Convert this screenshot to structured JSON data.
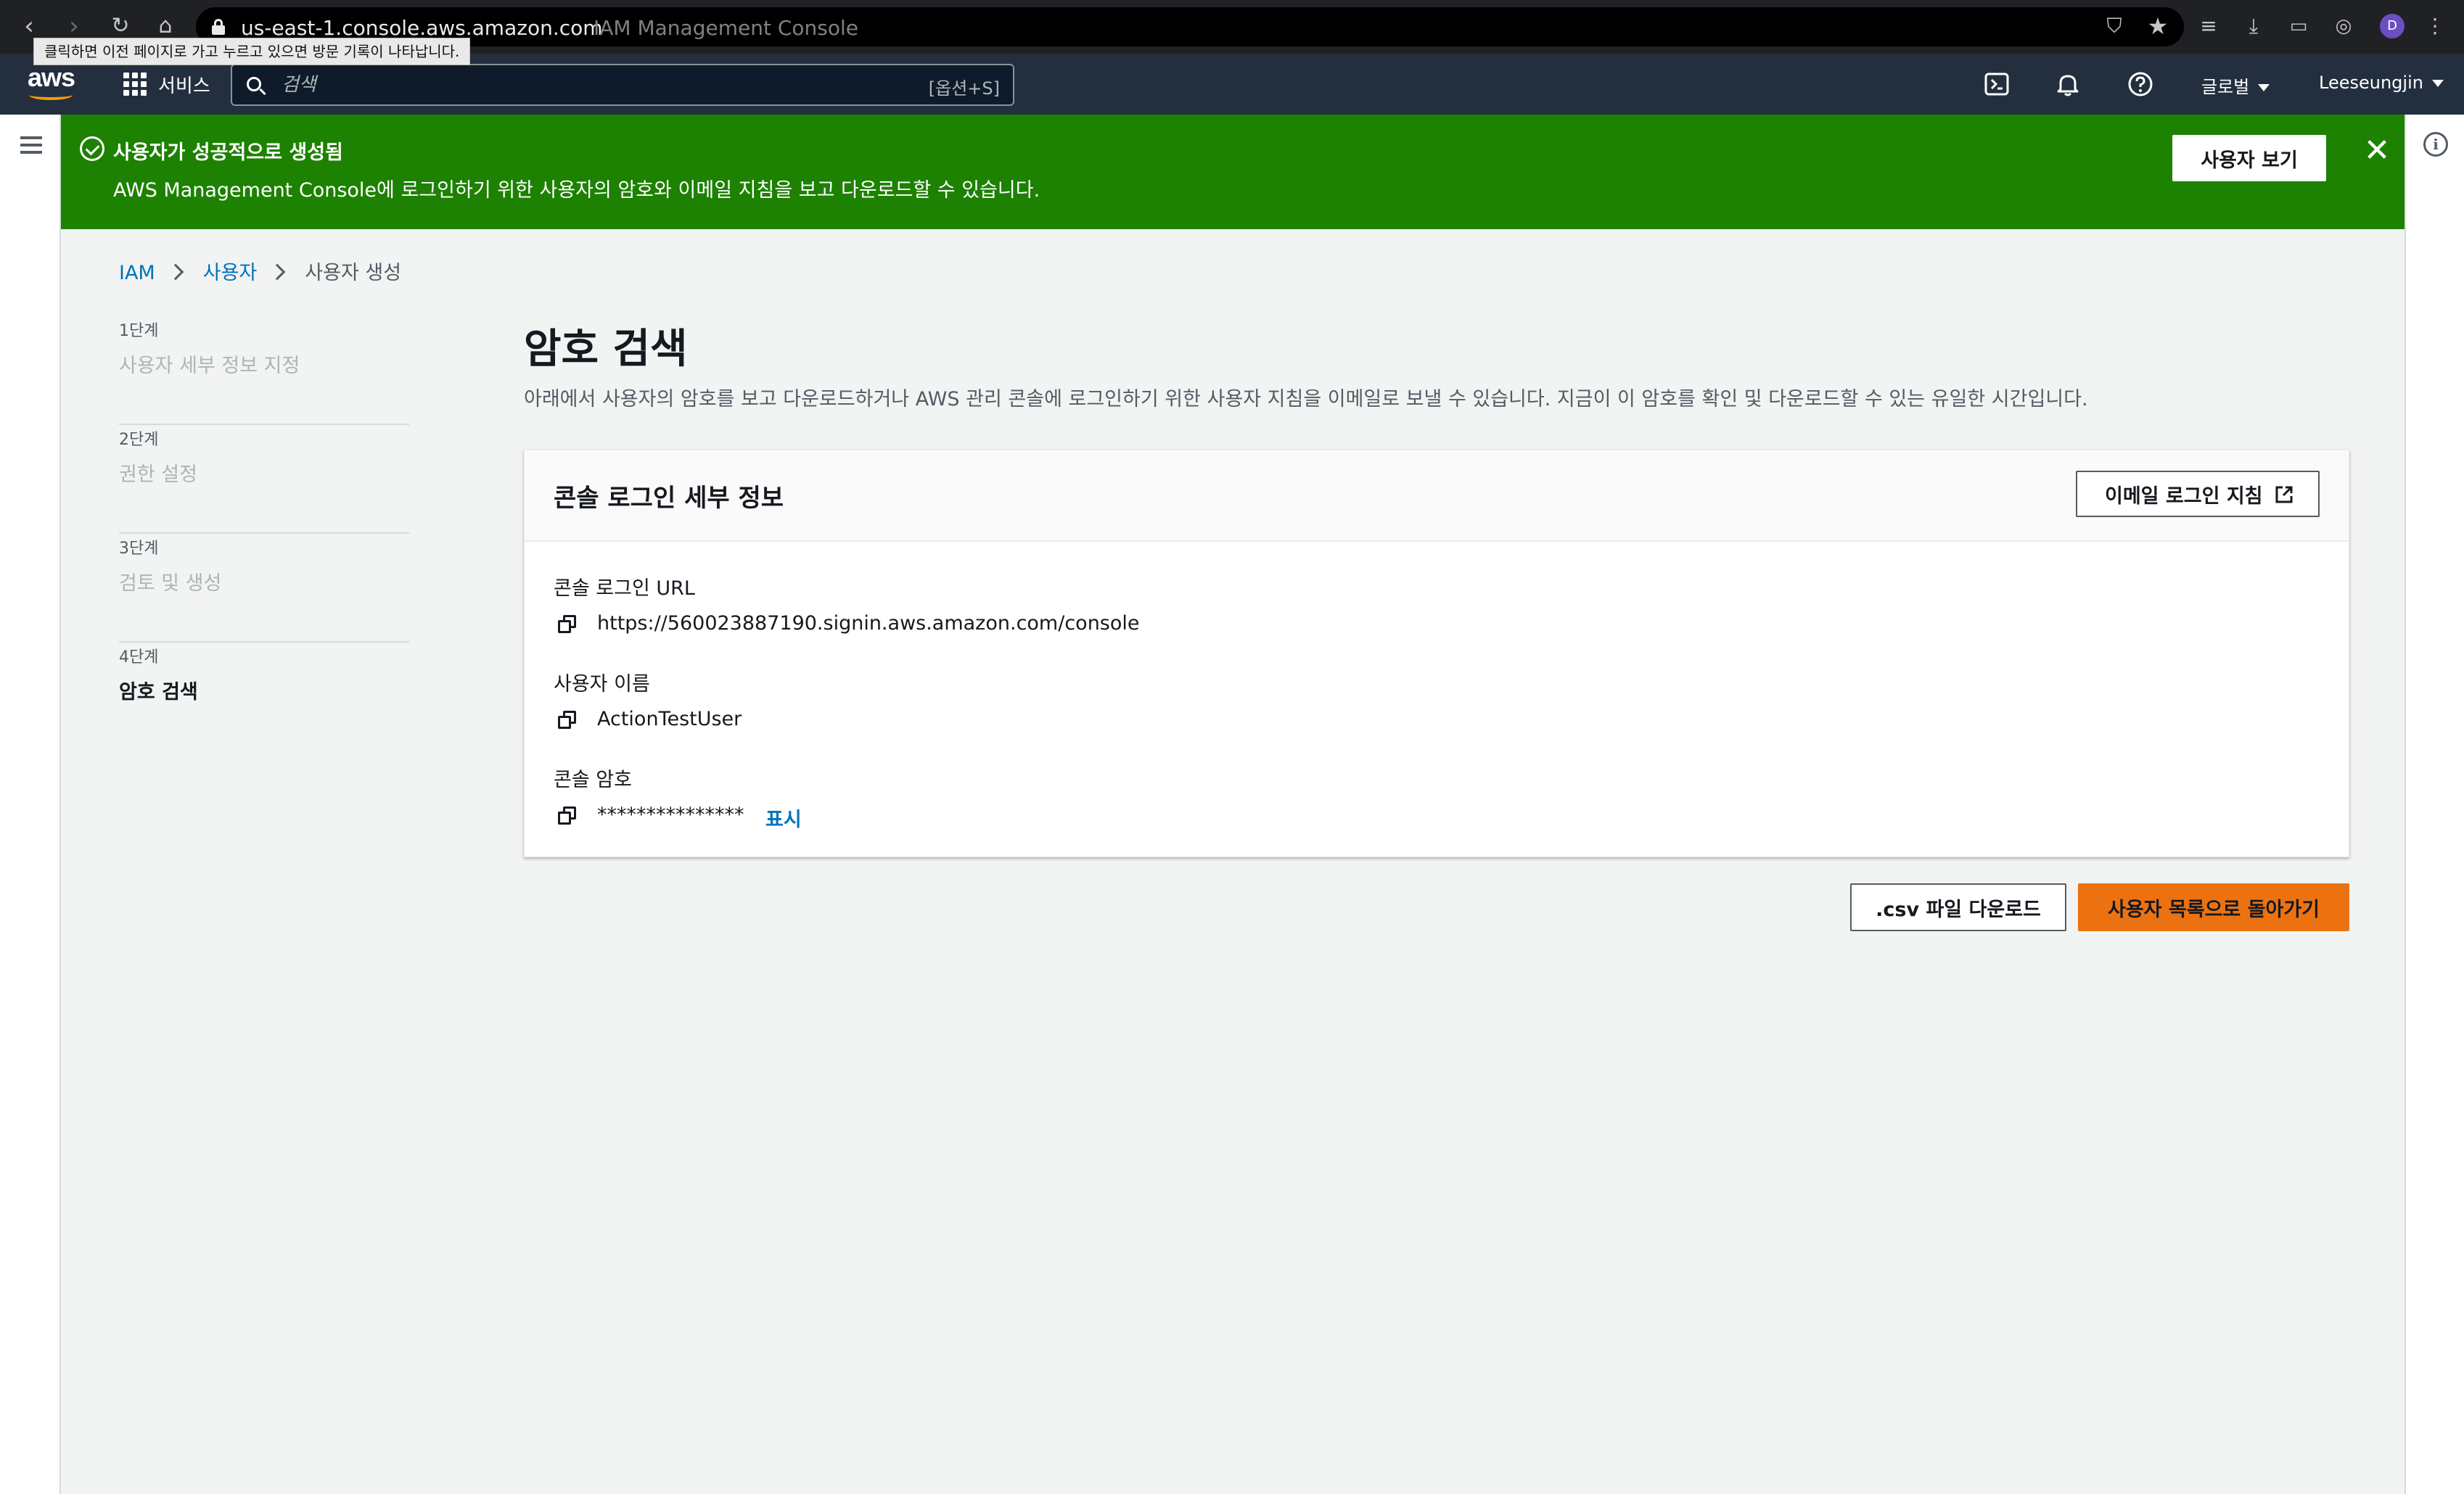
{
  "browser": {
    "url_host": "us-east-1.console.aws.amazon.com",
    "page_title": "IAM Management Console",
    "back_tooltip": "클릭하면 이전 페이지로 가고 누르고 있으면 방문 기록이 나타납니다.",
    "profile_initial": "D"
  },
  "aws_nav": {
    "logo_text": "aws",
    "services_label": "서비스",
    "search_placeholder": "검색",
    "search_shortcut": "[옵션+S]",
    "region_label": "글로벌",
    "account_label": "Leeseungjin"
  },
  "flash": {
    "title": "사용자가 성공적으로 생성됨",
    "message": "AWS Management Console에 로그인하기 위한 사용자의 암호와 이메일 지침을 보고 다운로드할 수 있습니다.",
    "button_label": "사용자 보기",
    "color": "#1d8102"
  },
  "breadcrumb": {
    "items": [
      "IAM",
      "사용자",
      "사용자 생성"
    ]
  },
  "steps": [
    {
      "number": "1단계",
      "label": "사용자 세부 정보 지정"
    },
    {
      "number": "2단계",
      "label": "권한 설정"
    },
    {
      "number": "3단계",
      "label": "검토 및 생성"
    },
    {
      "number": "4단계",
      "label": "암호 검색"
    }
  ],
  "main": {
    "title": "암호 검색",
    "description": "아래에서 사용자의 암호를 보고 다운로드하거나 AWS 관리 콘솔에 로그인하기 위한 사용자 지침을 이메일로 보낼 수 있습니다. 지금이 이 암호를 확인 및 다운로드할 수 있는 유일한 시간입니다."
  },
  "details": {
    "title": "콘솔 로그인 세부 정보",
    "email_button": "이메일 로그인 지침",
    "fields": [
      {
        "label": "콘솔 로그인 URL",
        "value": "https://560023887190.signin.aws.amazon.com/console"
      },
      {
        "label": "사용자 이름",
        "value": "ActionTestUser"
      },
      {
        "label": "콘솔 암호",
        "value": "***************",
        "link": "표시"
      }
    ]
  },
  "actions": {
    "csv_button": ".csv 파일 다운로드",
    "back_button": "사용자 목록으로 돌아가기",
    "primary_color": "#ec7211"
  }
}
